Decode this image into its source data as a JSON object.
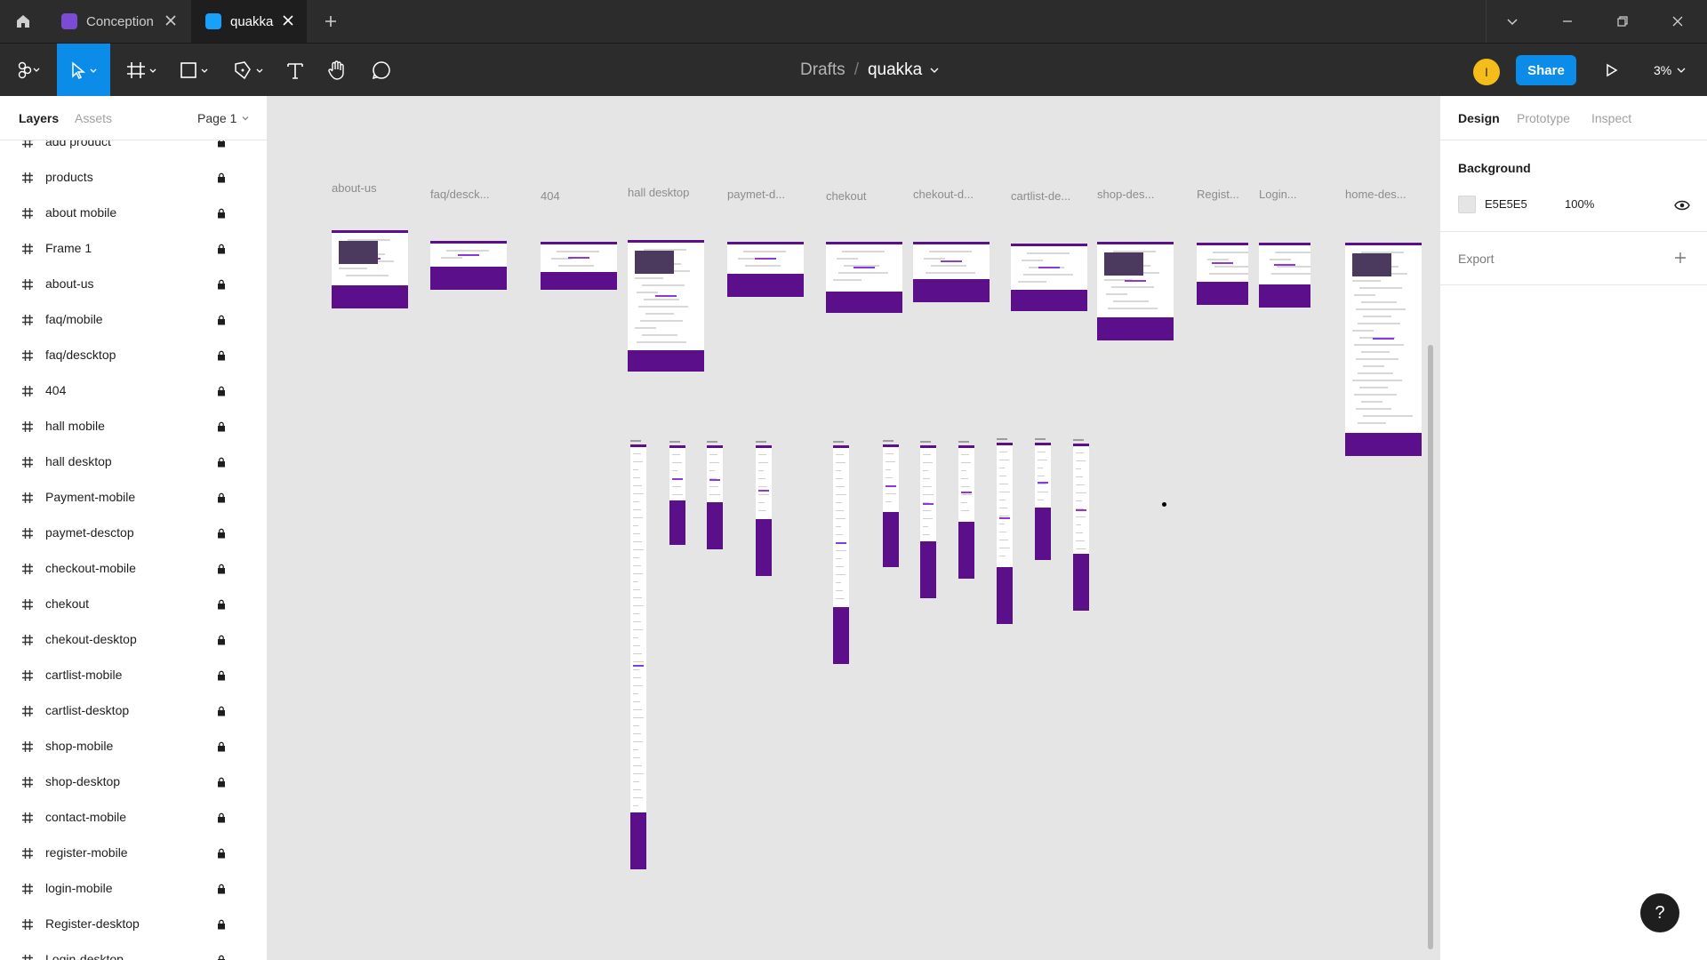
{
  "tabs": [
    {
      "label": "Conception",
      "icon": "figjam-file-icon",
      "color": "#7b4bd6"
    },
    {
      "label": "quakka",
      "icon": "design-file-icon",
      "color": "#18a0fb"
    }
  ],
  "breadcrumb": {
    "project": "Drafts",
    "separator": "/",
    "file": "quakka"
  },
  "toolbar": {
    "share_label": "Share",
    "zoom": "3%",
    "avatar_initial": "I"
  },
  "left_panel": {
    "tabs": [
      "Layers",
      "Assets"
    ],
    "page": "Page 1",
    "layers": [
      "add product",
      "products",
      "about mobile",
      "Frame 1",
      "about-us",
      "faq/mobile",
      "faq/descktop",
      "404",
      "hall mobile",
      "hall desktop",
      "Payment-mobile",
      "paymet-desctop",
      "checkout-mobile",
      "chekout",
      "chekout-desktop",
      "cartlist-mobile",
      "cartlist-desktop",
      "shop-mobile",
      "shop-desktop",
      "contact-mobile",
      "register-mobile",
      "login-mobile",
      "Register-desktop",
      "Login-desktop"
    ]
  },
  "canvas": {
    "background": "#E5E5E5",
    "frame_labels": [
      "about-us",
      "faq/desck...",
      "404",
      "hall desktop",
      "paymet-d...",
      "chekout",
      "chekout-d...",
      "cartlist-de...",
      "shop-des...",
      "Regist...",
      "Login...",
      "home-des..."
    ],
    "accent_color": "#5C0F8B"
  },
  "right_panel": {
    "tabs": [
      "Design",
      "Prototype",
      "Inspect"
    ],
    "background_title": "Background",
    "background_hex": "E5E5E5",
    "background_opacity": "100%",
    "export_title": "Export",
    "help": "?"
  }
}
